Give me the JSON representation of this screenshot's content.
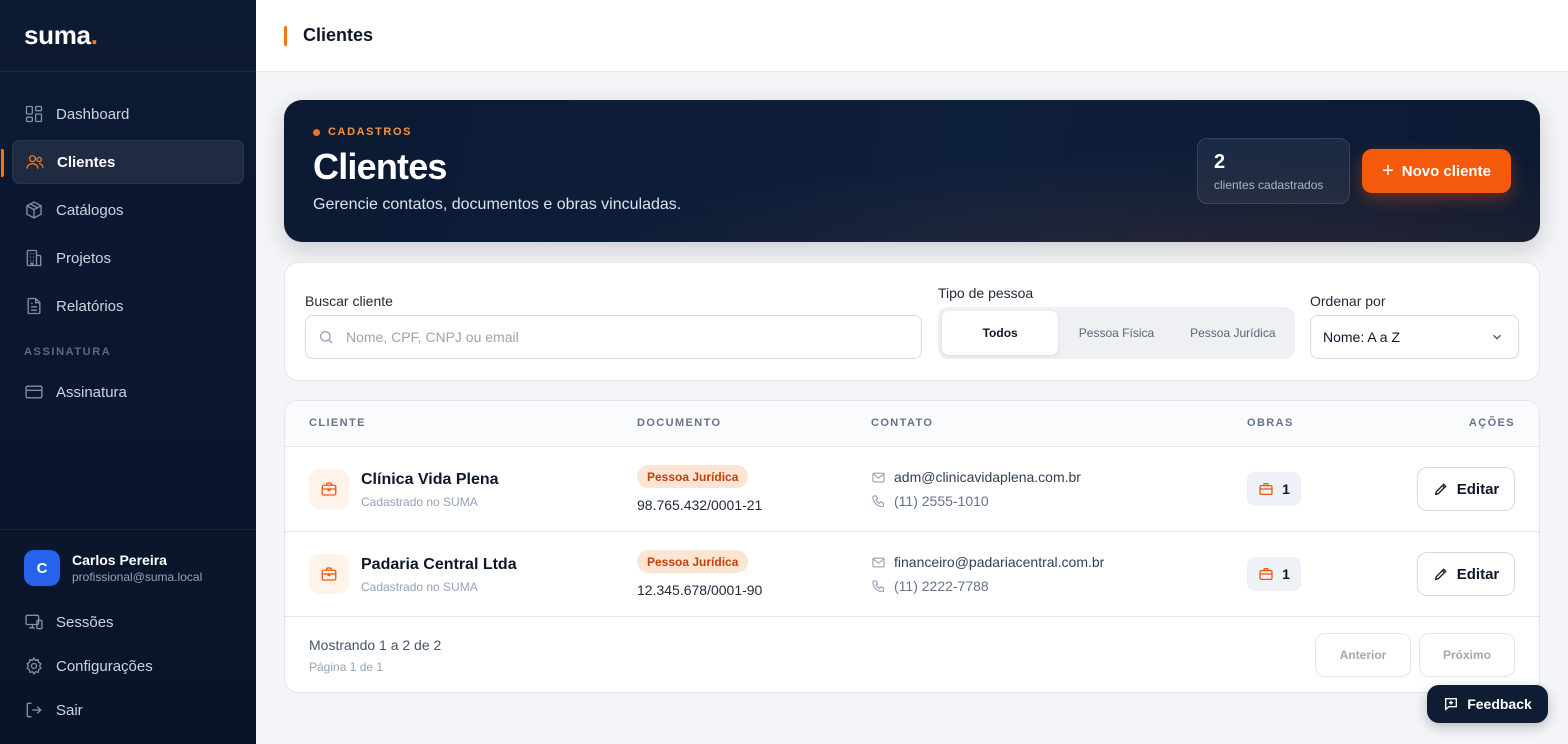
{
  "brand": {
    "name": "suma",
    "dot": "."
  },
  "sidebar": {
    "items": [
      {
        "label": "Dashboard",
        "icon": "dashboard-icon"
      },
      {
        "label": "Clientes",
        "icon": "users-icon",
        "active": true
      },
      {
        "label": "Catálogos",
        "icon": "box-icon"
      },
      {
        "label": "Projetos",
        "icon": "building-icon"
      },
      {
        "label": "Relatórios",
        "icon": "file-text-icon"
      }
    ],
    "section_label": "ASSINATURA",
    "subscription": {
      "label": "Assinatura",
      "icon": "credit-card-icon"
    },
    "user": {
      "initial": "C",
      "name": "Carlos Pereira",
      "email": "profissional@suma.local"
    },
    "bottom": [
      {
        "label": "Sessões",
        "icon": "devices-icon"
      },
      {
        "label": "Configurações",
        "icon": "gear-icon"
      },
      {
        "label": "Sair",
        "icon": "logout-icon"
      }
    ]
  },
  "topbar": {
    "title": "Clientes"
  },
  "hero": {
    "eyebrow": "CADASTROS",
    "title": "Clientes",
    "subtitle": "Gerencie contatos, documentos e obras vinculadas.",
    "stat_value": "2",
    "stat_label": "clientes cadastrados",
    "new_button": "Novo cliente"
  },
  "filters": {
    "search_label": "Buscar cliente",
    "search_placeholder": "Nome, CPF, CNPJ ou email",
    "type_label": "Tipo de pessoa",
    "type_options": [
      "Todos",
      "Pessoa Física",
      "Pessoa Jurídica"
    ],
    "type_selected": "Todos",
    "order_label": "Ordenar por",
    "order_value": "Nome: A a Z"
  },
  "table": {
    "headers": [
      "CLIENTE",
      "DOCUMENTO",
      "CONTATO",
      "OBRAS",
      "AÇÕES"
    ],
    "rows": [
      {
        "name": "Clínica Vida Plena",
        "subtitle": "Cadastrado no SUMA",
        "badge": "Pessoa Jurídica",
        "document": "98.765.432/0001-21",
        "email": "adm@clinicavidaplena.com.br",
        "phone": "(11) 2555-1010",
        "obras": "1",
        "action": "Editar"
      },
      {
        "name": "Padaria Central Ltda",
        "subtitle": "Cadastrado no SUMA",
        "badge": "Pessoa Jurídica",
        "document": "12.345.678/0001-90",
        "email": "financeiro@padariacentral.com.br",
        "phone": "(11) 2222-7788",
        "obras": "1",
        "action": "Editar"
      }
    ],
    "showing": "Mostrando 1 a 2 de 2",
    "page_of": "Página 1 de 1",
    "prev": "Anterior",
    "next": "Próximo"
  },
  "feedback": {
    "label": "Feedback"
  },
  "colors": {
    "accent": "#f55a0c",
    "sidebar_bg": "#0d1a33",
    "badge_bg": "#fde5d4",
    "badge_text": "#c2410c"
  }
}
